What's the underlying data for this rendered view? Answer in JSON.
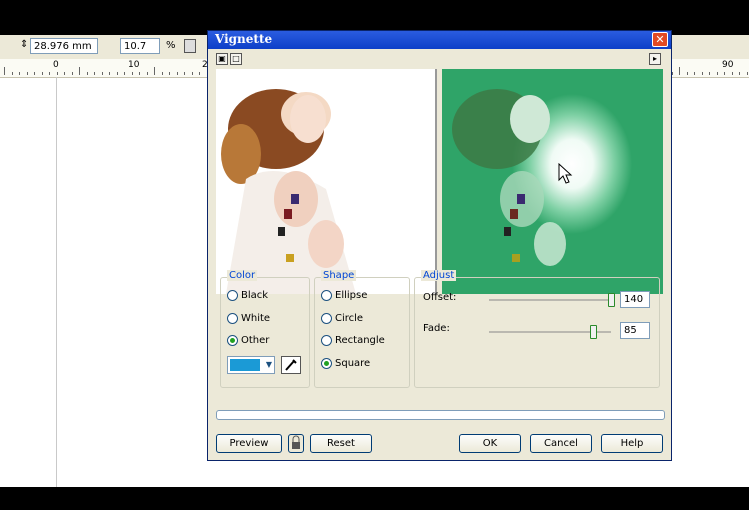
{
  "property_bar": {
    "size_value": "28.976 mm",
    "percent_value": "10.7",
    "percent_unit": "%"
  },
  "ruler": {
    "labels": [
      "0",
      "10",
      "2",
      "90"
    ]
  },
  "dialog": {
    "title": "Vignette",
    "color_group": {
      "label": "Color",
      "options": [
        "Black",
        "White",
        "Other"
      ],
      "selected": "Other",
      "swatch_color": "#1b9ad6"
    },
    "shape_group": {
      "label": "Shape",
      "options": [
        "Ellipse",
        "Circle",
        "Rectangle",
        "Square"
      ],
      "selected": "Square"
    },
    "adjust_group": {
      "label": "Adjust",
      "offset_label": "Offset:",
      "offset_value": "140",
      "fade_label": "Fade:",
      "fade_value": "85"
    },
    "buttons": {
      "preview": "Preview",
      "reset": "Reset",
      "ok": "OK",
      "cancel": "Cancel",
      "help": "Help"
    }
  },
  "colors": {
    "title_bar": "#0d3fc8",
    "dialog_bg": "#ece9d8",
    "group_label": "#0046d5",
    "vignette_green": "#2fa468"
  }
}
